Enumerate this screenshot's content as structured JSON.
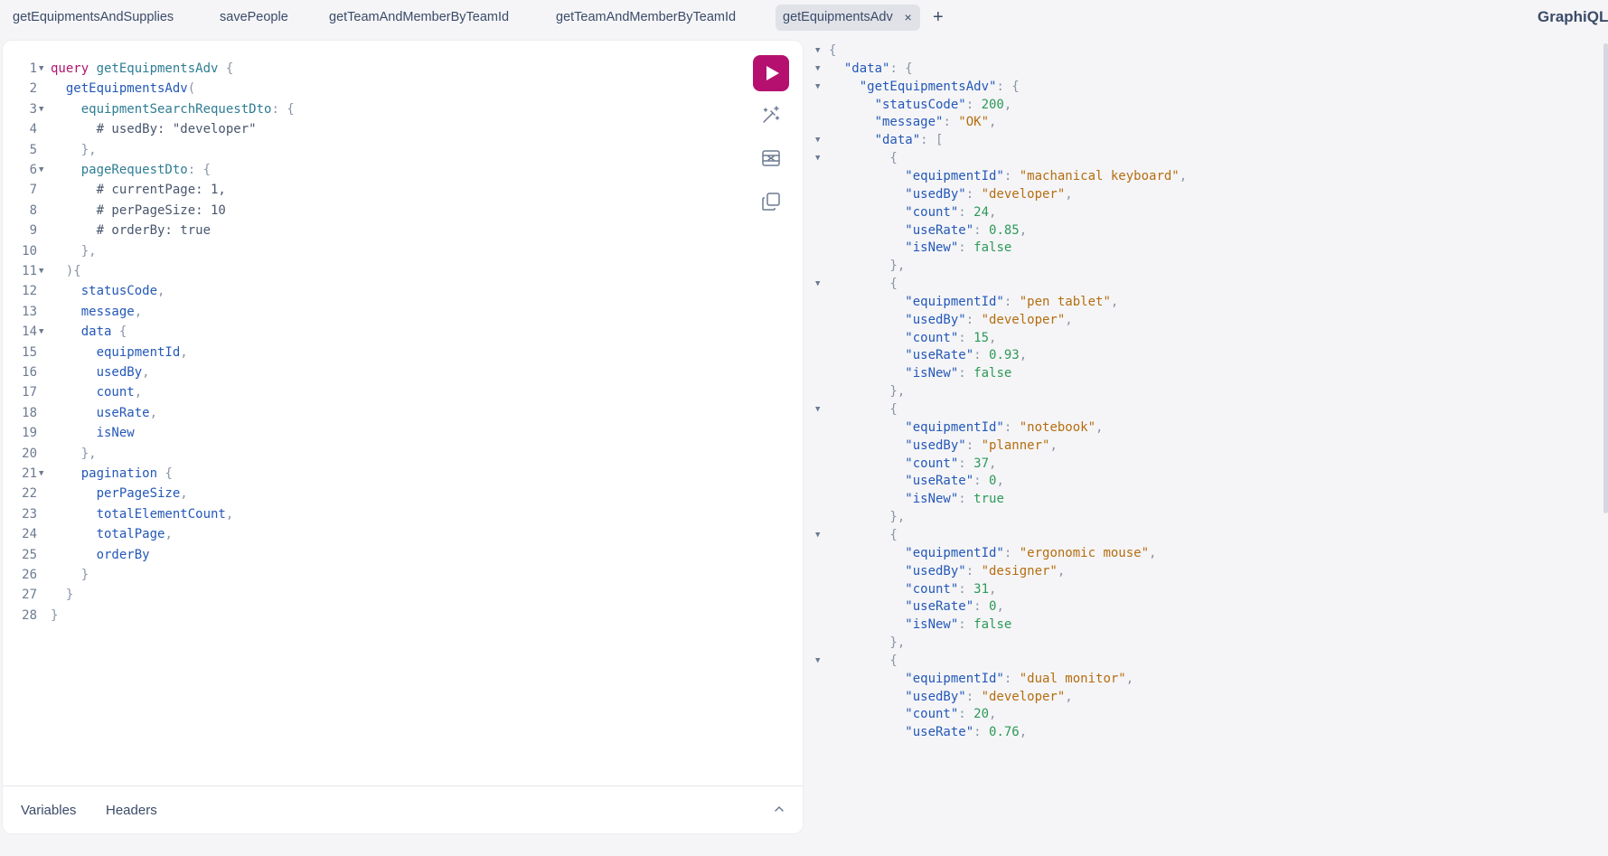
{
  "tabs": [
    {
      "label": "getEquipmentsAndSupplies",
      "active": false
    },
    {
      "label": "savePeople",
      "active": false
    },
    {
      "label": "getTeamAndMemberByTeamId",
      "active": false
    },
    {
      "label": "getTeamAndMemberByTeamId",
      "active": false
    },
    {
      "label": "getEquipmentsAdv",
      "active": true
    }
  ],
  "add_tab_label": "+",
  "close_tab_label": "×",
  "brand": "GraphiQL",
  "editor": {
    "lines": [
      {
        "n": "1",
        "fold": true,
        "tokens": [
          [
            "kw",
            "query "
          ],
          [
            "fn",
            "getEquipmentsAdv"
          ],
          [
            "pn",
            " {"
          ]
        ]
      },
      {
        "n": "2",
        "fold": false,
        "tokens": [
          [
            "fld",
            "  getEquipmentsAdv"
          ],
          [
            "pn",
            "("
          ]
        ]
      },
      {
        "n": "3",
        "fold": true,
        "tokens": [
          [
            "arg",
            "    equipmentSearchRequestDto"
          ],
          [
            "pn",
            ": {"
          ]
        ]
      },
      {
        "n": "4",
        "fold": false,
        "tokens": [
          [
            "cmt",
            "      # usedBy: \"developer\""
          ]
        ]
      },
      {
        "n": "5",
        "fold": false,
        "tokens": [
          [
            "pn",
            "    },"
          ]
        ]
      },
      {
        "n": "6",
        "fold": true,
        "tokens": [
          [
            "arg",
            "    pageRequestDto"
          ],
          [
            "pn",
            ": {"
          ]
        ]
      },
      {
        "n": "7",
        "fold": false,
        "tokens": [
          [
            "cmt",
            "      # currentPage: 1,"
          ]
        ]
      },
      {
        "n": "8",
        "fold": false,
        "tokens": [
          [
            "cmt",
            "      # perPageSize: 10"
          ]
        ]
      },
      {
        "n": "9",
        "fold": false,
        "tokens": [
          [
            "cmt",
            "      # orderBy: true"
          ]
        ]
      },
      {
        "n": "10",
        "fold": false,
        "tokens": [
          [
            "pn",
            "    },"
          ]
        ]
      },
      {
        "n": "11",
        "fold": true,
        "tokens": [
          [
            "pn",
            "  ){"
          ]
        ]
      },
      {
        "n": "12",
        "fold": false,
        "tokens": [
          [
            "fld",
            "    statusCode"
          ],
          [
            "pn",
            ","
          ]
        ]
      },
      {
        "n": "13",
        "fold": false,
        "tokens": [
          [
            "fld",
            "    message"
          ],
          [
            "pn",
            ","
          ]
        ]
      },
      {
        "n": "14",
        "fold": true,
        "tokens": [
          [
            "fld",
            "    data"
          ],
          [
            "pn",
            " {"
          ]
        ]
      },
      {
        "n": "15",
        "fold": false,
        "tokens": [
          [
            "fld",
            "      equipmentId"
          ],
          [
            "pn",
            ","
          ]
        ]
      },
      {
        "n": "16",
        "fold": false,
        "tokens": [
          [
            "fld",
            "      usedBy"
          ],
          [
            "pn",
            ","
          ]
        ]
      },
      {
        "n": "17",
        "fold": false,
        "tokens": [
          [
            "fld",
            "      count"
          ],
          [
            "pn",
            ","
          ]
        ]
      },
      {
        "n": "18",
        "fold": false,
        "tokens": [
          [
            "fld",
            "      useRate"
          ],
          [
            "pn",
            ","
          ]
        ]
      },
      {
        "n": "19",
        "fold": false,
        "tokens": [
          [
            "fld",
            "      isNew"
          ]
        ]
      },
      {
        "n": "20",
        "fold": false,
        "tokens": [
          [
            "pn",
            "    },"
          ]
        ]
      },
      {
        "n": "21",
        "fold": true,
        "tokens": [
          [
            "fld",
            "    pagination"
          ],
          [
            "pn",
            " {"
          ]
        ]
      },
      {
        "n": "22",
        "fold": false,
        "tokens": [
          [
            "fld",
            "      perPageSize"
          ],
          [
            "pn",
            ","
          ]
        ]
      },
      {
        "n": "23",
        "fold": false,
        "tokens": [
          [
            "fld",
            "      totalElementCount"
          ],
          [
            "pn",
            ","
          ]
        ]
      },
      {
        "n": "24",
        "fold": false,
        "tokens": [
          [
            "fld",
            "      totalPage"
          ],
          [
            "pn",
            ","
          ]
        ]
      },
      {
        "n": "25",
        "fold": false,
        "tokens": [
          [
            "fld",
            "      orderBy"
          ]
        ]
      },
      {
        "n": "26",
        "fold": false,
        "tokens": [
          [
            "pn",
            "    }"
          ]
        ]
      },
      {
        "n": "27",
        "fold": false,
        "tokens": [
          [
            "pn",
            "  }"
          ]
        ]
      },
      {
        "n": "28",
        "fold": false,
        "tokens": [
          [
            "pn",
            "}"
          ]
        ]
      }
    ]
  },
  "toolbar": {
    "run_icon": "play-icon",
    "prettify_icon": "prettify-icon",
    "merge_icon": "merge-fragments-icon",
    "copy_icon": "copy-icon"
  },
  "bottom_tabs": {
    "variables": "Variables",
    "headers": "Headers"
  },
  "result": {
    "lines": [
      {
        "fold": true,
        "tokens": [
          [
            "pn",
            "{"
          ]
        ]
      },
      {
        "fold": true,
        "tokens": [
          [
            "key",
            "  \"data\""
          ],
          [
            "pn",
            ": {"
          ]
        ]
      },
      {
        "fold": true,
        "tokens": [
          [
            "key",
            "    \"getEquipmentsAdv\""
          ],
          [
            "pn",
            ": {"
          ]
        ]
      },
      {
        "fold": false,
        "tokens": [
          [
            "key",
            "      \"statusCode\""
          ],
          [
            "pn",
            ": "
          ],
          [
            "num",
            "200"
          ],
          [
            "pn",
            ","
          ]
        ]
      },
      {
        "fold": false,
        "tokens": [
          [
            "key",
            "      \"message\""
          ],
          [
            "pn",
            ": "
          ],
          [
            "str",
            "\"OK\""
          ],
          [
            "pn",
            ","
          ]
        ]
      },
      {
        "fold": true,
        "tokens": [
          [
            "key",
            "      \"data\""
          ],
          [
            "pn",
            ": ["
          ]
        ]
      },
      {
        "fold": true,
        "tokens": [
          [
            "pn",
            "        {"
          ]
        ]
      },
      {
        "fold": false,
        "tokens": [
          [
            "key",
            "          \"equipmentId\""
          ],
          [
            "pn",
            ": "
          ],
          [
            "str",
            "\"machanical keyboard\""
          ],
          [
            "pn",
            ","
          ]
        ]
      },
      {
        "fold": false,
        "tokens": [
          [
            "key",
            "          \"usedBy\""
          ],
          [
            "pn",
            ": "
          ],
          [
            "str",
            "\"developer\""
          ],
          [
            "pn",
            ","
          ]
        ]
      },
      {
        "fold": false,
        "tokens": [
          [
            "key",
            "          \"count\""
          ],
          [
            "pn",
            ": "
          ],
          [
            "num",
            "24"
          ],
          [
            "pn",
            ","
          ]
        ]
      },
      {
        "fold": false,
        "tokens": [
          [
            "key",
            "          \"useRate\""
          ],
          [
            "pn",
            ": "
          ],
          [
            "num",
            "0.85"
          ],
          [
            "pn",
            ","
          ]
        ]
      },
      {
        "fold": false,
        "tokens": [
          [
            "key",
            "          \"isNew\""
          ],
          [
            "pn",
            ": "
          ],
          [
            "bool",
            "false"
          ]
        ]
      },
      {
        "fold": false,
        "tokens": [
          [
            "pn",
            "        },"
          ]
        ]
      },
      {
        "fold": true,
        "tokens": [
          [
            "pn",
            "        {"
          ]
        ]
      },
      {
        "fold": false,
        "tokens": [
          [
            "key",
            "          \"equipmentId\""
          ],
          [
            "pn",
            ": "
          ],
          [
            "str",
            "\"pen tablet\""
          ],
          [
            "pn",
            ","
          ]
        ]
      },
      {
        "fold": false,
        "tokens": [
          [
            "key",
            "          \"usedBy\""
          ],
          [
            "pn",
            ": "
          ],
          [
            "str",
            "\"developer\""
          ],
          [
            "pn",
            ","
          ]
        ]
      },
      {
        "fold": false,
        "tokens": [
          [
            "key",
            "          \"count\""
          ],
          [
            "pn",
            ": "
          ],
          [
            "num",
            "15"
          ],
          [
            "pn",
            ","
          ]
        ]
      },
      {
        "fold": false,
        "tokens": [
          [
            "key",
            "          \"useRate\""
          ],
          [
            "pn",
            ": "
          ],
          [
            "num",
            "0.93"
          ],
          [
            "pn",
            ","
          ]
        ]
      },
      {
        "fold": false,
        "tokens": [
          [
            "key",
            "          \"isNew\""
          ],
          [
            "pn",
            ": "
          ],
          [
            "bool",
            "false"
          ]
        ]
      },
      {
        "fold": false,
        "tokens": [
          [
            "pn",
            "        },"
          ]
        ]
      },
      {
        "fold": true,
        "tokens": [
          [
            "pn",
            "        {"
          ]
        ]
      },
      {
        "fold": false,
        "tokens": [
          [
            "key",
            "          \"equipmentId\""
          ],
          [
            "pn",
            ": "
          ],
          [
            "str",
            "\"notebook\""
          ],
          [
            "pn",
            ","
          ]
        ]
      },
      {
        "fold": false,
        "tokens": [
          [
            "key",
            "          \"usedBy\""
          ],
          [
            "pn",
            ": "
          ],
          [
            "str",
            "\"planner\""
          ],
          [
            "pn",
            ","
          ]
        ]
      },
      {
        "fold": false,
        "tokens": [
          [
            "key",
            "          \"count\""
          ],
          [
            "pn",
            ": "
          ],
          [
            "num",
            "37"
          ],
          [
            "pn",
            ","
          ]
        ]
      },
      {
        "fold": false,
        "tokens": [
          [
            "key",
            "          \"useRate\""
          ],
          [
            "pn",
            ": "
          ],
          [
            "num",
            "0"
          ],
          [
            "pn",
            ","
          ]
        ]
      },
      {
        "fold": false,
        "tokens": [
          [
            "key",
            "          \"isNew\""
          ],
          [
            "pn",
            ": "
          ],
          [
            "bool",
            "true"
          ]
        ]
      },
      {
        "fold": false,
        "tokens": [
          [
            "pn",
            "        },"
          ]
        ]
      },
      {
        "fold": true,
        "tokens": [
          [
            "pn",
            "        {"
          ]
        ]
      },
      {
        "fold": false,
        "tokens": [
          [
            "key",
            "          \"equipmentId\""
          ],
          [
            "pn",
            ": "
          ],
          [
            "str",
            "\"ergonomic mouse\""
          ],
          [
            "pn",
            ","
          ]
        ]
      },
      {
        "fold": false,
        "tokens": [
          [
            "key",
            "          \"usedBy\""
          ],
          [
            "pn",
            ": "
          ],
          [
            "str",
            "\"designer\""
          ],
          [
            "pn",
            ","
          ]
        ]
      },
      {
        "fold": false,
        "tokens": [
          [
            "key",
            "          \"count\""
          ],
          [
            "pn",
            ": "
          ],
          [
            "num",
            "31"
          ],
          [
            "pn",
            ","
          ]
        ]
      },
      {
        "fold": false,
        "tokens": [
          [
            "key",
            "          \"useRate\""
          ],
          [
            "pn",
            ": "
          ],
          [
            "num",
            "0"
          ],
          [
            "pn",
            ","
          ]
        ]
      },
      {
        "fold": false,
        "tokens": [
          [
            "key",
            "          \"isNew\""
          ],
          [
            "pn",
            ": "
          ],
          [
            "bool",
            "false"
          ]
        ]
      },
      {
        "fold": false,
        "tokens": [
          [
            "pn",
            "        },"
          ]
        ]
      },
      {
        "fold": true,
        "tokens": [
          [
            "pn",
            "        {"
          ]
        ]
      },
      {
        "fold": false,
        "tokens": [
          [
            "key",
            "          \"equipmentId\""
          ],
          [
            "pn",
            ": "
          ],
          [
            "str",
            "\"dual monitor\""
          ],
          [
            "pn",
            ","
          ]
        ]
      },
      {
        "fold": false,
        "tokens": [
          [
            "key",
            "          \"usedBy\""
          ],
          [
            "pn",
            ": "
          ],
          [
            "str",
            "\"developer\""
          ],
          [
            "pn",
            ","
          ]
        ]
      },
      {
        "fold": false,
        "tokens": [
          [
            "key",
            "          \"count\""
          ],
          [
            "pn",
            ": "
          ],
          [
            "num",
            "20"
          ],
          [
            "pn",
            ","
          ]
        ]
      },
      {
        "fold": false,
        "tokens": [
          [
            "key",
            "          \"useRate\""
          ],
          [
            "pn",
            ": "
          ],
          [
            "num",
            "0.76"
          ],
          [
            "pn",
            ","
          ]
        ]
      }
    ]
  },
  "colors": {
    "accent": "#b5106f",
    "background": "#f5f5f7",
    "panel": "#ffffff"
  }
}
